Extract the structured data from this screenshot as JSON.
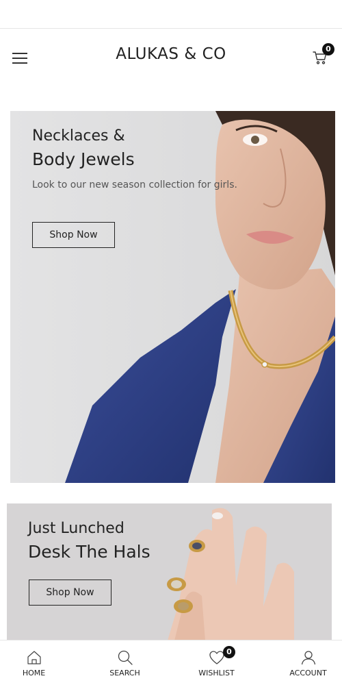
{
  "header": {
    "logo": "ALUKAS & CO",
    "cart_count": "0"
  },
  "banners": [
    {
      "eyebrow": "Necklaces &",
      "title": "Body Jewels",
      "subtitle": "Look to our new season collection for girls.",
      "button_label": "Shop Now"
    },
    {
      "eyebrow": "Just Lunched",
      "title": "Desk The Hals",
      "button_label": "Shop Now"
    }
  ],
  "bottom_nav": [
    {
      "label": "HOME",
      "icon": "home-icon"
    },
    {
      "label": "SEARCH",
      "icon": "search-icon"
    },
    {
      "label": "WISHLIST",
      "icon": "heart-icon",
      "count": "0"
    },
    {
      "label": "ACCOUNT",
      "icon": "user-icon"
    }
  ],
  "colors": {
    "banner1_bg": "#dededf",
    "banner2_bg": "#d6d4d5",
    "jacket": "#2d3f86",
    "gold": "#c79a45"
  }
}
